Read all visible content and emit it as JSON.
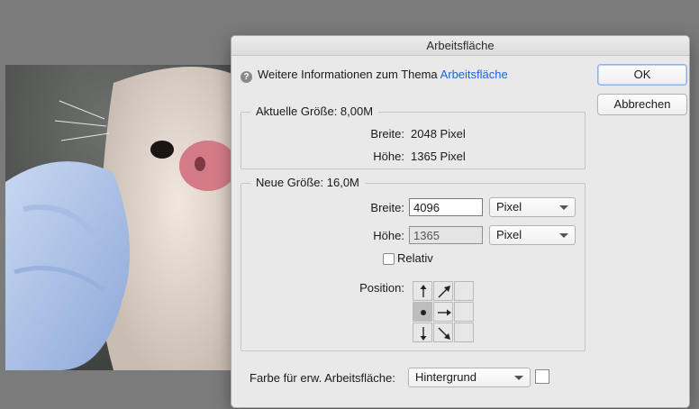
{
  "dialog": {
    "title": "Arbeitsfläche",
    "info": {
      "text": "Weitere Informationen zum Thema",
      "link": "Arbeitsfläche"
    },
    "buttons": {
      "ok": "OK",
      "cancel": "Abbrechen"
    },
    "current_size": {
      "legend": "Aktuelle Größe: 8,00M",
      "width_label": "Breite:",
      "width_value": "2048 Pixel",
      "height_label": "Höhe:",
      "height_value": "1365 Pixel"
    },
    "new_size": {
      "legend": "Neue Größe: 16,0M",
      "width_label": "Breite:",
      "width_value": "4096",
      "width_unit": "Pixel",
      "height_label": "Höhe:",
      "height_value": "1365",
      "height_unit": "Pixel",
      "relative_label": "Relativ",
      "relative_checked": false,
      "position_label": "Position:",
      "anchor": "middle-left"
    },
    "canvas_color": {
      "label": "Farbe für erw. Arbeitsfläche:",
      "value": "Hintergrund",
      "swatch_color": "#ffffff"
    }
  },
  "colors": {
    "background": "#7b7b7b",
    "link": "#1f62d6",
    "dialog_bg": "#e9e9e9"
  }
}
